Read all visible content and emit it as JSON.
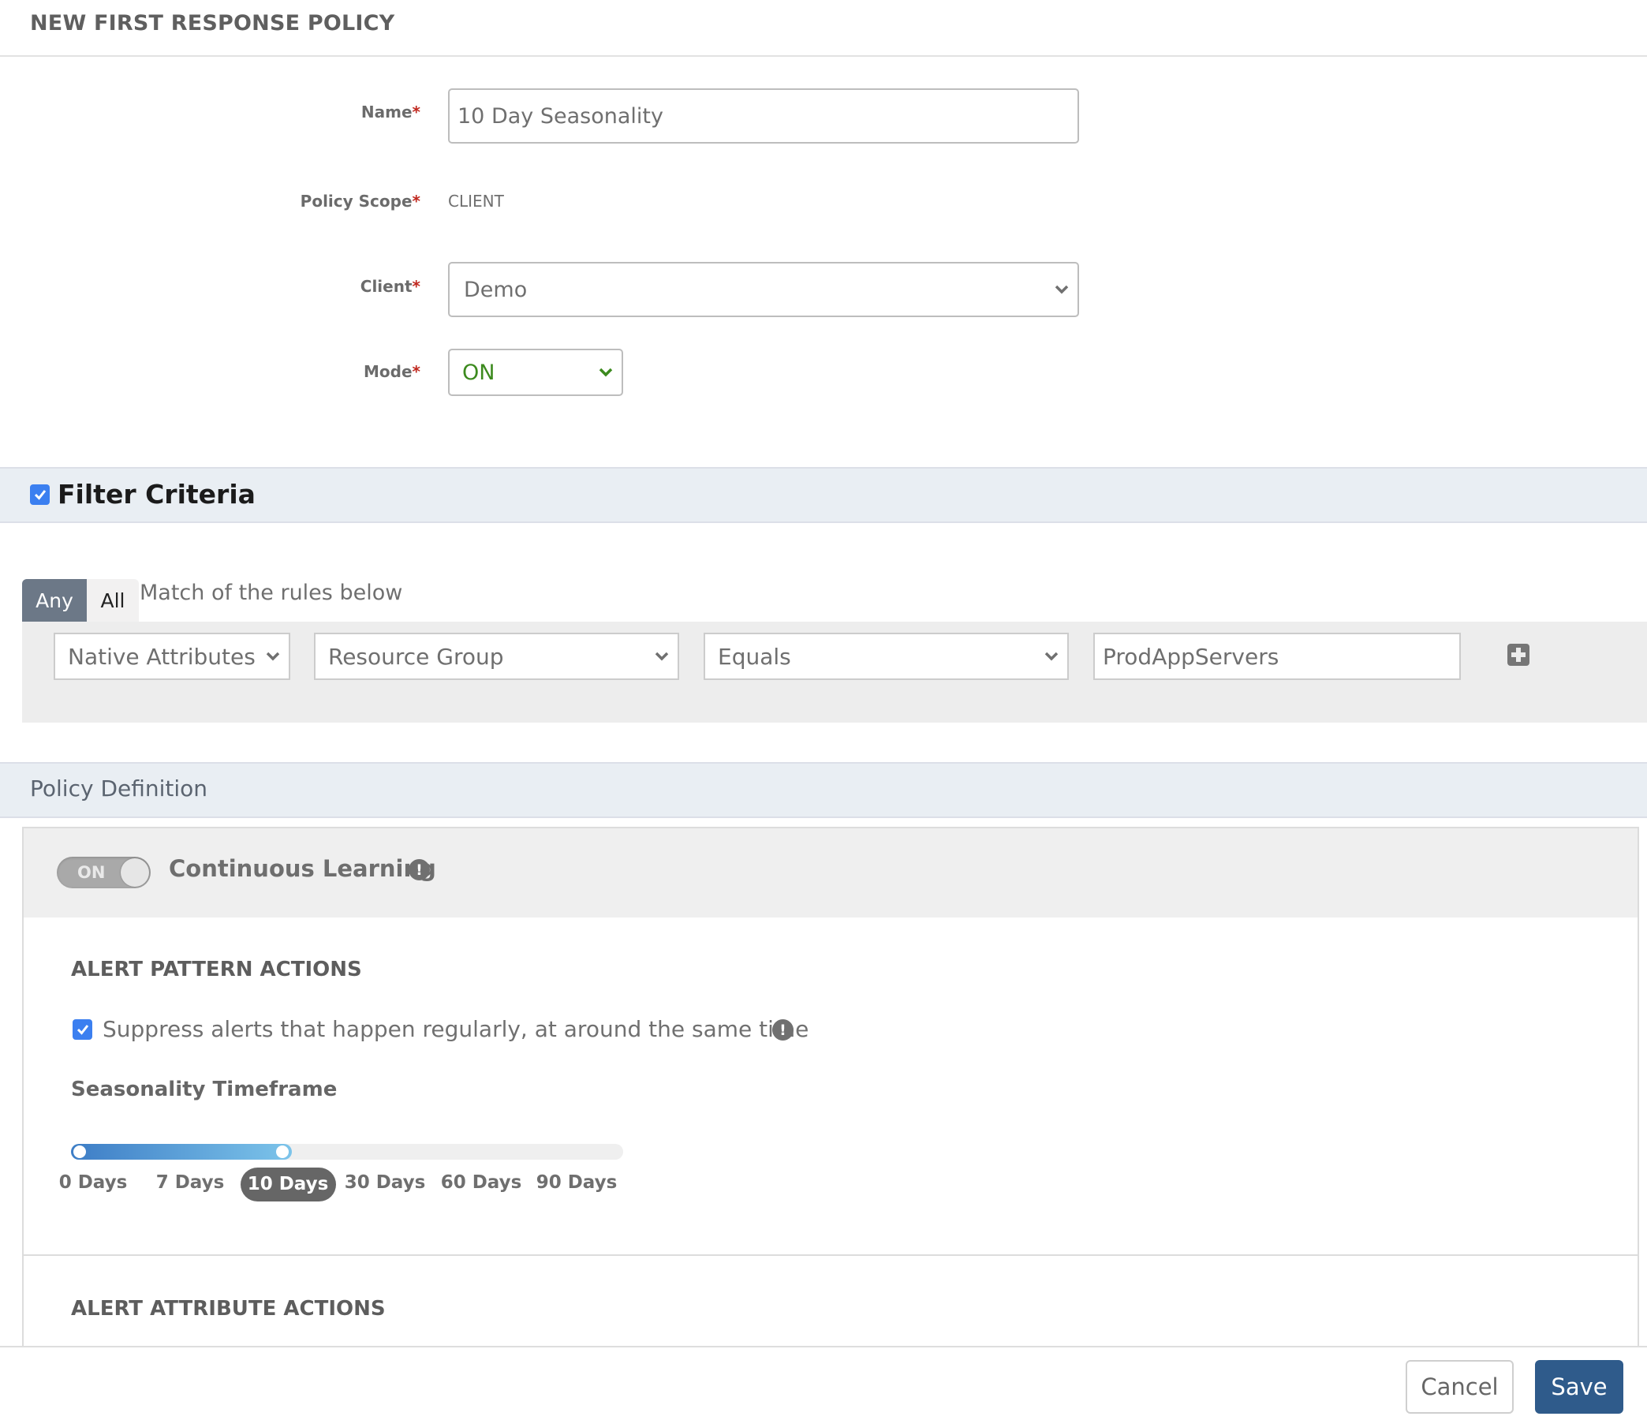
{
  "header": {
    "title": "NEW FIRST RESPONSE POLICY"
  },
  "form": {
    "name": {
      "label": "Name",
      "value": "10 Day Seasonality"
    },
    "policy_scope": {
      "label": "Policy Scope",
      "value": "CLIENT"
    },
    "client": {
      "label": "Client",
      "value": "Demo"
    },
    "mode": {
      "label": "Mode",
      "value": "ON"
    },
    "required_marker": "*"
  },
  "filter_criteria": {
    "title": "Filter Criteria",
    "enabled": true,
    "match": {
      "options": [
        "Any",
        "All"
      ],
      "selected": "Any",
      "text": "Match of the rules below"
    },
    "rules": [
      {
        "attribute_type": "Native Attributes",
        "attribute": "Resource Group",
        "operator": "Equals",
        "value": "ProdAppServers"
      }
    ]
  },
  "policy_definition": {
    "title": "Policy Definition",
    "continuous_learning": {
      "label": "Continuous Learning",
      "toggle": "ON",
      "info_icon": "!"
    },
    "alert_pattern_actions": {
      "title": "ALERT PATTERN ACTIONS",
      "suppress": {
        "checked": true,
        "label": "Suppress alerts that happen regularly, at around the same time",
        "info_icon": "!"
      },
      "seasonality": {
        "label": "Seasonality Timeframe",
        "ticks": [
          "0 Days",
          "7 Days",
          "10 Days",
          "30 Days",
          "60 Days",
          "90 Days"
        ],
        "selected": "10 Days",
        "range_start": "0 Days"
      }
    },
    "alert_attribute_actions": {
      "title": "ALERT ATTRIBUTE ACTIONS"
    }
  },
  "footer": {
    "cancel_label": "Cancel",
    "save_label": "Save"
  },
  "colors": {
    "primary": "#2f5b8b",
    "checkbox": "#3b7ff0",
    "mode_on": "#3c8a1e",
    "required": "#c0281f",
    "segment_active": "#6c7887"
  }
}
